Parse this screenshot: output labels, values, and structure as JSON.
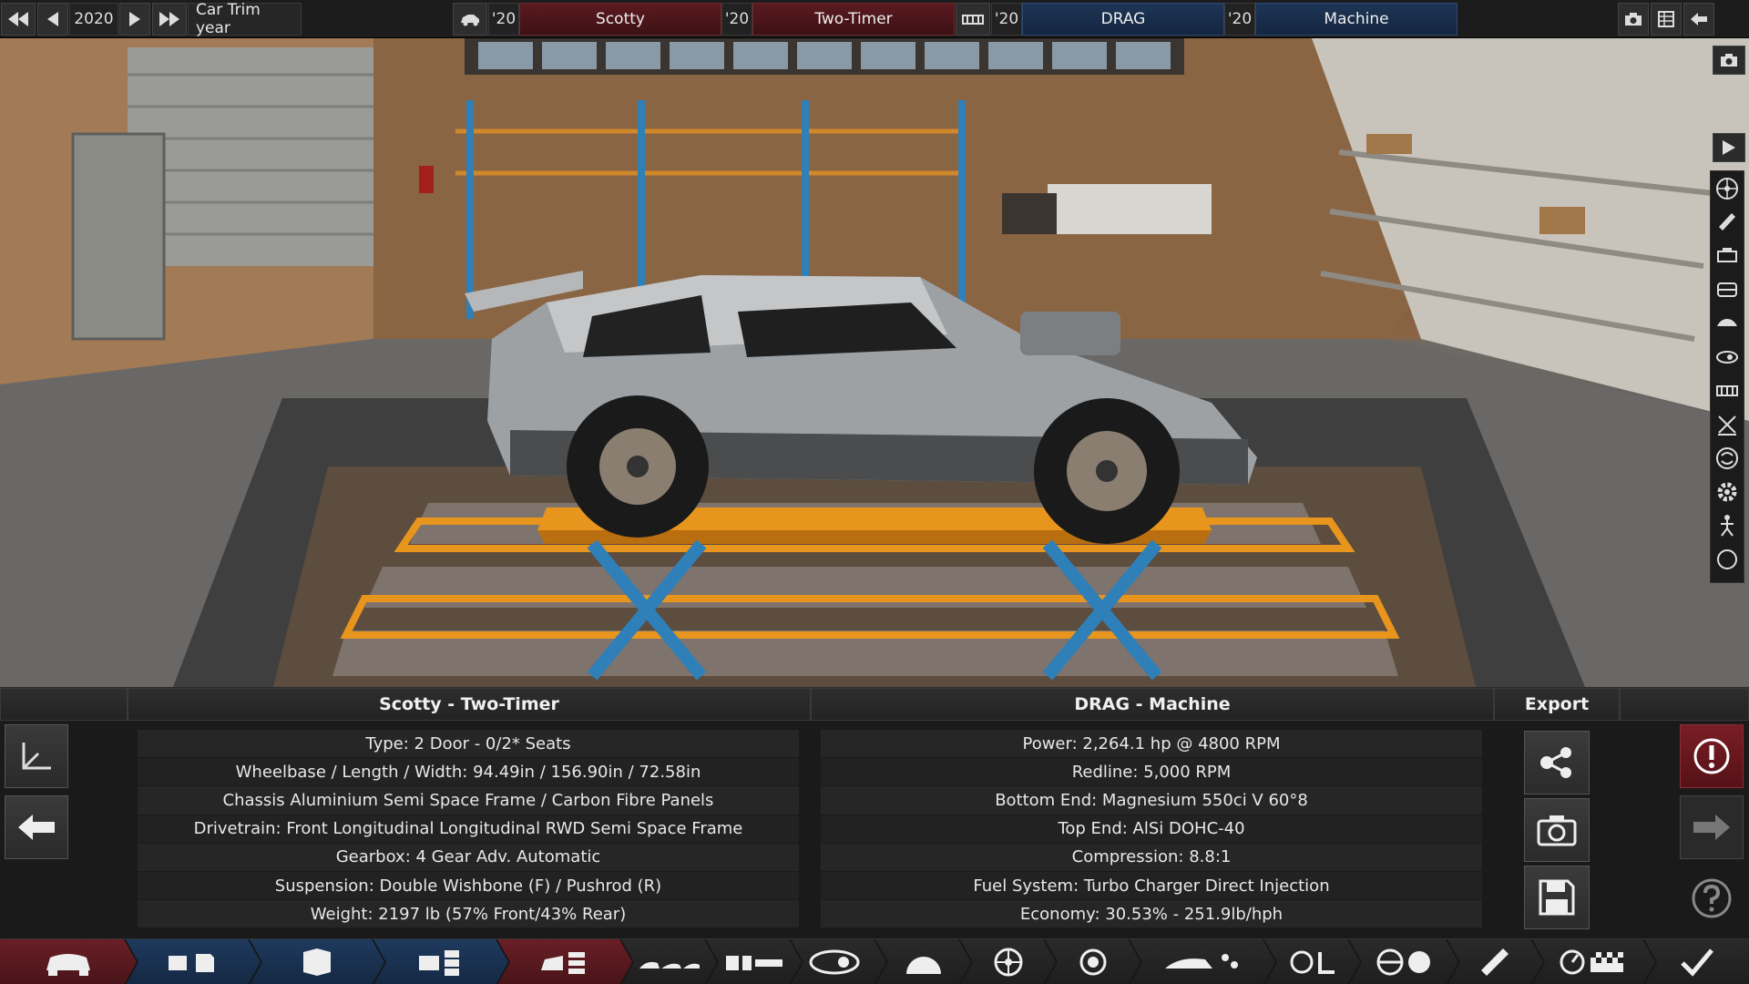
{
  "topbar": {
    "year": "2020",
    "year_label": "Car Trim year",
    "model_year": "'20",
    "model_name": "Scotty",
    "trim_year": "'20",
    "trim_name": "Two-Timer",
    "engine_family_year": "'20",
    "engine_family_name": "DRAG",
    "engine_variant_year": "'20",
    "engine_variant_name": "Machine"
  },
  "car_panel": {
    "title": "Scotty - Two-Timer",
    "specs": [
      "Type: 2 Door - 0/2* Seats",
      "Wheelbase / Length / Width: 94.49in / 156.90in / 72.58in",
      "Chassis Aluminium Semi Space Frame / Carbon Fibre Panels",
      "Drivetrain: Front Longitudinal Longitudinal RWD Semi Space Frame",
      "Gearbox: 4 Gear Adv. Automatic",
      "Suspension: Double Wishbone (F) / Pushrod (R)",
      "Weight: 2197 lb (57% Front/43% Rear)"
    ]
  },
  "engine_panel": {
    "title": "DRAG - Machine",
    "specs": [
      "Power: 2,264.1 hp @ 4800 RPM",
      "Redline:  5,000 RPM",
      "Bottom End: Magnesium 550ci V 60°8",
      "Top End: AlSi DOHC-40",
      "Compression: 8.8:1",
      "Fuel System: Turbo Charger Direct Injection",
      "Economy: 30.53% - 251.9lb/hph"
    ]
  },
  "export": {
    "title": "Export"
  },
  "colors": {
    "accent_red": "#6a1f26",
    "accent_blue": "#1f3a5e",
    "lift_orange": "#e8951d",
    "lift_blue": "#2f7fb8"
  }
}
